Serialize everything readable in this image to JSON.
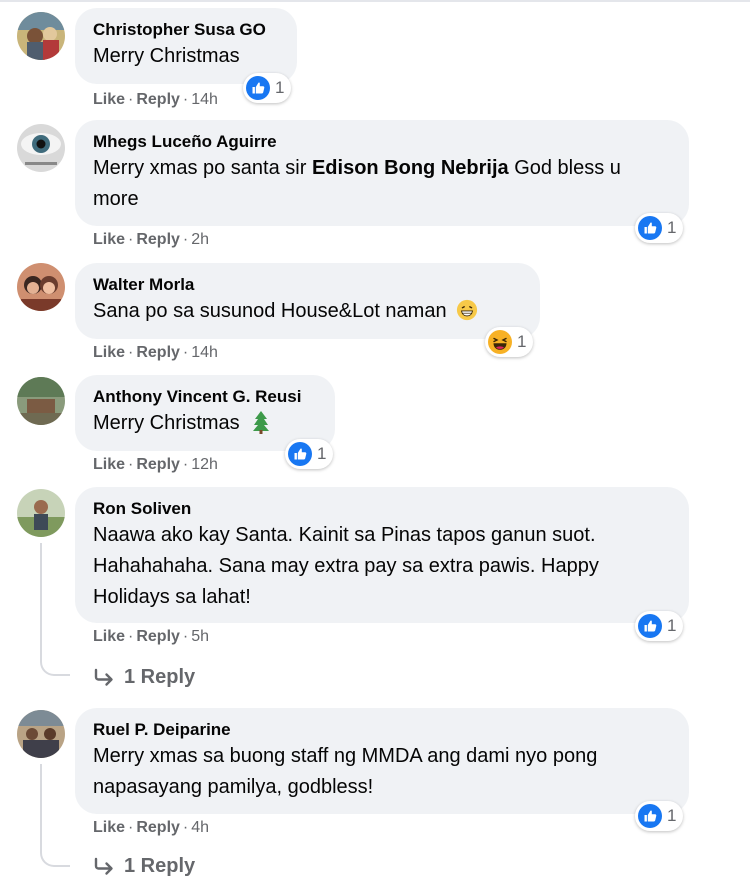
{
  "colors": {
    "bubble_bg": "#f0f2f5",
    "secondary_text": "#65676b",
    "like_blue": "#1877f2",
    "haha_yellow": "#f7b125"
  },
  "comments": [
    {
      "author": "Christopher Susa GO",
      "text": "Merry Christmas",
      "actions": {
        "like": "Like",
        "reply": "Reply",
        "time": "14h"
      },
      "reaction": {
        "icon": "like-icon",
        "count": "1"
      }
    },
    {
      "author": "Mhegs Luceño Aguirre",
      "text_before": "Merry xmas po santa sir ",
      "mention": "Edison Bong Nebrija",
      "text_after": " God bless u more",
      "actions": {
        "like": "Like",
        "reply": "Reply",
        "time": "2h"
      },
      "reaction": {
        "icon": "like-icon",
        "count": "1"
      }
    },
    {
      "author": "Walter Morla",
      "text": "Sana po sa susunod House&Lot naman",
      "emoji": "grinning-face-emoji",
      "actions": {
        "like": "Like",
        "reply": "Reply",
        "time": "14h"
      },
      "reaction": {
        "icon": "haha-icon",
        "count": "1"
      }
    },
    {
      "author": "Anthony Vincent G. Reusi",
      "text": "Merry Christmas",
      "emoji": "christmas-tree-emoji",
      "actions": {
        "like": "Like",
        "reply": "Reply",
        "time": "12h"
      },
      "reaction": {
        "icon": "like-icon",
        "count": "1"
      }
    },
    {
      "author": "Ron Soliven",
      "text": "Naawa ako kay Santa. Kainit sa Pinas tapos ganun suot. Hahahahaha. Sana may extra pay sa extra pawis. Happy Holidays sa lahat!",
      "actions": {
        "like": "Like",
        "reply": "Reply",
        "time": "5h"
      },
      "reaction": {
        "icon": "like-icon",
        "count": "1"
      },
      "replies": "1 Reply"
    },
    {
      "author": "Ruel P. Deiparine",
      "text": "Merry xmas sa buong staff ng MMDA ang dami nyo pong napasayang pamilya, godbless!",
      "actions": {
        "like": "Like",
        "reply": "Reply",
        "time": "4h"
      },
      "reaction": {
        "icon": "like-icon",
        "count": "1"
      },
      "replies": "1 Reply"
    }
  ]
}
